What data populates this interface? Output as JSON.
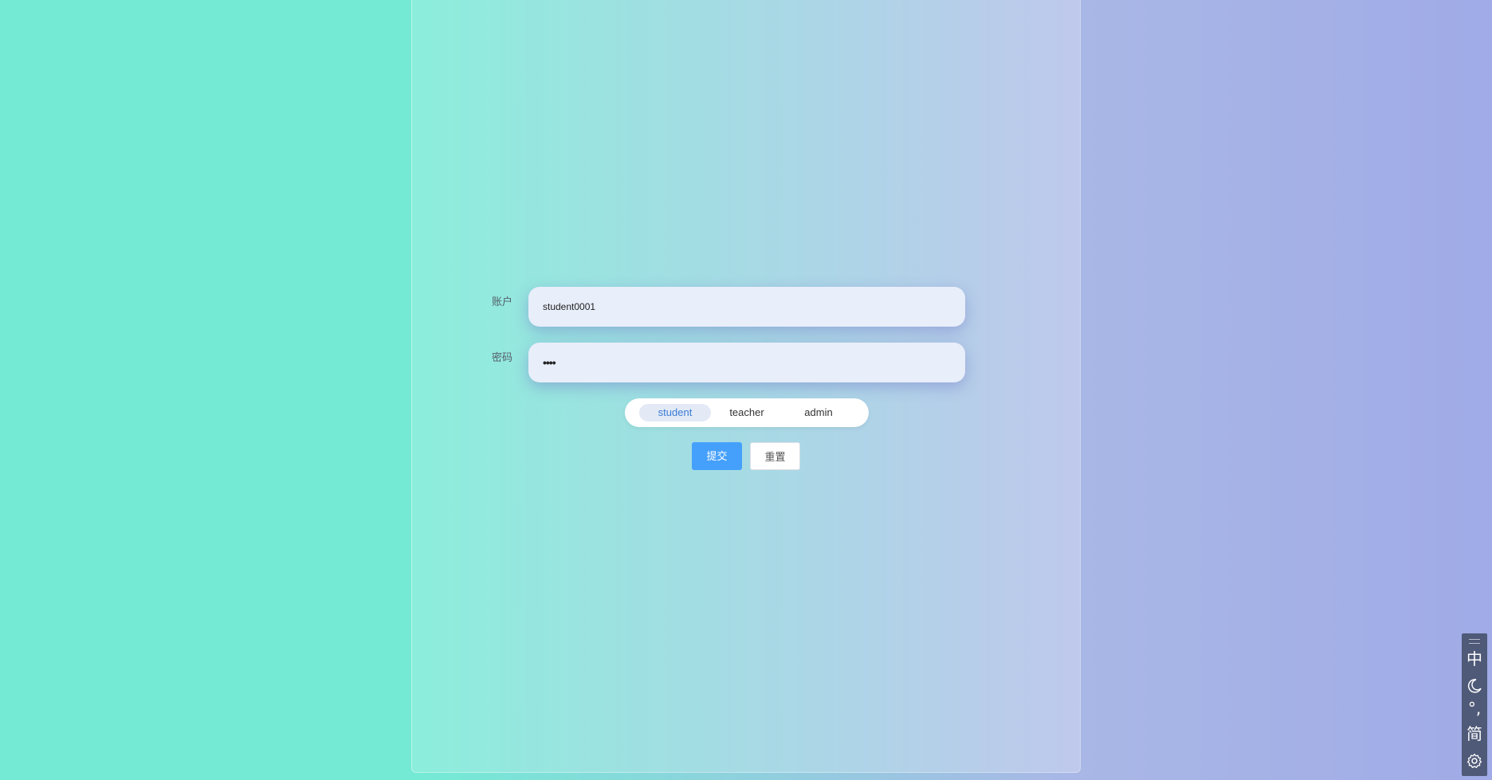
{
  "form": {
    "account_label": "账户",
    "account_value": "student0001",
    "password_label": "密码",
    "password_value": "••••"
  },
  "roles": {
    "selected": "student",
    "options": [
      "student",
      "teacher",
      "admin"
    ]
  },
  "buttons": {
    "submit_label": "提交",
    "reset_label": "重置"
  },
  "ime_toolbar": {
    "language": "中",
    "punctuation": "°,",
    "script": "简",
    "icons": [
      "drag-handle-icon",
      "moon-icon",
      "gear-icon"
    ]
  },
  "colors": {
    "primary": "#45a0fb",
    "bg_left": "#74ead5",
    "bg_right": "#a0abe7",
    "input_bg": "#e8eefa",
    "ime_bg": "#4f5a78"
  }
}
